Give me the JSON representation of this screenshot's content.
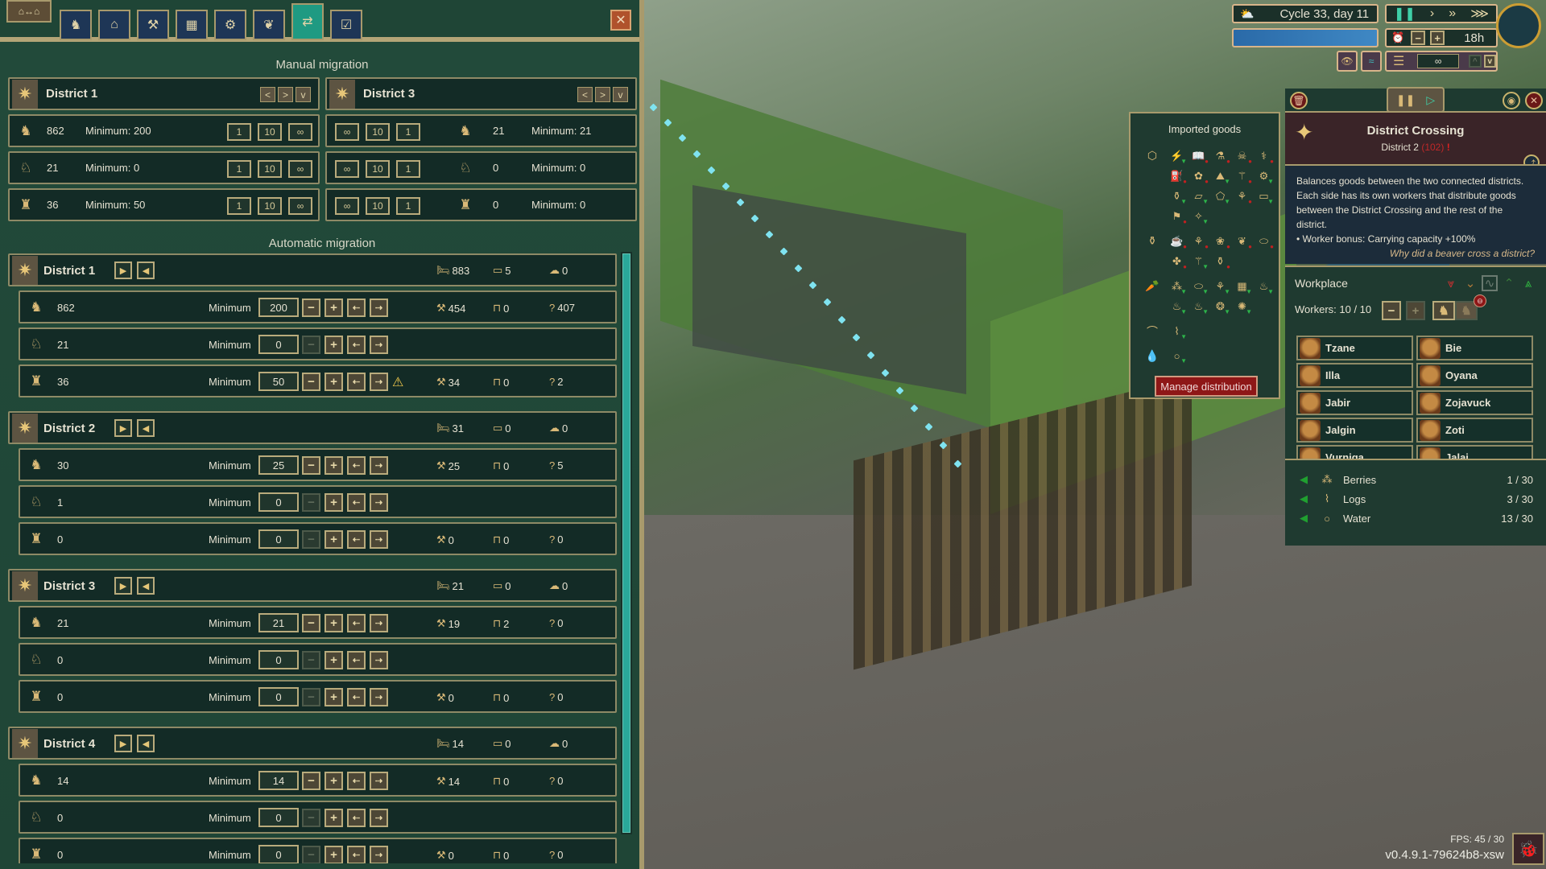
{
  "tabs": {
    "home_label": "⌂↔⌂",
    "items": [
      {
        "name": "tab-population",
        "icon": "♞"
      },
      {
        "name": "tab-housing",
        "icon": "⌂"
      },
      {
        "name": "tab-workplaces",
        "icon": "⚒"
      },
      {
        "name": "tab-storage",
        "icon": "▦"
      },
      {
        "name": "tab-power",
        "icon": "⚙"
      },
      {
        "name": "tab-wellbeing",
        "icon": "❦"
      },
      {
        "name": "tab-migration",
        "icon": "⇄"
      },
      {
        "name": "tab-distribution",
        "icon": "☑"
      }
    ],
    "close_label": "✕"
  },
  "manual": {
    "title": "Manual migration",
    "left": {
      "district": "District 1",
      "rows": [
        {
          "count": "862",
          "minimum": "Minimum: 200"
        },
        {
          "count": "21",
          "minimum": "Minimum: 0"
        },
        {
          "count": "36",
          "minimum": "Minimum: 50"
        }
      ]
    },
    "right": {
      "district": "District 3",
      "rows": [
        {
          "count": "21",
          "minimum": "Minimum: 21"
        },
        {
          "count": "0",
          "minimum": "Minimum: 0"
        },
        {
          "count": "0",
          "minimum": "Minimum: 0"
        }
      ]
    },
    "send_buttons": [
      "1",
      "10",
      "∞"
    ],
    "receive_buttons": [
      "∞",
      "10",
      "1"
    ],
    "nav": {
      "prev": "<",
      "next": ">",
      "dropdown": "v"
    }
  },
  "auto": {
    "title": "Automatic migration",
    "minimum_label": "Minimum",
    "districts": [
      {
        "name": "District 1",
        "beds_total": "883",
        "beds_free": "5",
        "homeless": "0",
        "rows": [
          {
            "count": "862",
            "minimum": "200",
            "minus_enabled": true,
            "employed": "454",
            "unemployed_bench": "0",
            "idle": "407",
            "warning": false
          },
          {
            "count": "21",
            "minimum": "0",
            "minus_enabled": false
          },
          {
            "count": "36",
            "minimum": "50",
            "minus_enabled": true,
            "employed": "34",
            "unemployed_bench": "0",
            "idle": "2",
            "warning": true
          }
        ]
      },
      {
        "name": "District 2",
        "beds_total": "31",
        "beds_free": "0",
        "homeless": "0",
        "rows": [
          {
            "count": "30",
            "minimum": "25",
            "minus_enabled": true,
            "employed": "25",
            "unemployed_bench": "0",
            "idle": "5"
          },
          {
            "count": "1",
            "minimum": "0",
            "minus_enabled": false
          },
          {
            "count": "0",
            "minimum": "0",
            "minus_enabled": false,
            "employed": "0",
            "unemployed_bench": "0",
            "idle": "0"
          }
        ]
      },
      {
        "name": "District 3",
        "beds_total": "21",
        "beds_free": "0",
        "homeless": "0",
        "rows": [
          {
            "count": "21",
            "minimum": "21",
            "minus_enabled": true,
            "employed": "19",
            "unemployed_bench": "2",
            "idle": "0"
          },
          {
            "count": "0",
            "minimum": "0",
            "minus_enabled": false
          },
          {
            "count": "0",
            "minimum": "0",
            "minus_enabled": false,
            "employed": "0",
            "unemployed_bench": "0",
            "idle": "0"
          }
        ]
      },
      {
        "name": "District 4",
        "beds_total": "14",
        "beds_free": "0",
        "homeless": "0",
        "rows": [
          {
            "count": "14",
            "minimum": "14",
            "minus_enabled": true,
            "employed": "14",
            "unemployed_bench": "0",
            "idle": "0"
          },
          {
            "count": "0",
            "minimum": "0",
            "minus_enabled": false
          },
          {
            "count": "0",
            "minimum": "0",
            "minus_enabled": false,
            "employed": "0",
            "unemployed_bench": "0",
            "idle": "0"
          }
        ]
      }
    ]
  },
  "hud": {
    "cycle": "Cycle 33, day 11",
    "time_remaining": "18h",
    "layer_value": "∞",
    "speeds": [
      "❚❚",
      "›",
      "»",
      "⋙"
    ]
  },
  "imported_goods": {
    "title": "Imported goods",
    "rows": [
      {
        "category": "⬡",
        "goods": [
          [
            "⚡",
            "down"
          ],
          [
            "📖",
            "blocked"
          ],
          [
            "⚗",
            "blocked"
          ],
          [
            "☠",
            "blocked"
          ],
          [
            "⚕",
            "blocked"
          ]
        ]
      },
      {
        "category": "",
        "goods": [
          [
            "⛽",
            "blocked"
          ],
          [
            "✿",
            "blocked"
          ],
          [
            "⛰",
            "down"
          ],
          [
            "⚚",
            "blocked"
          ],
          [
            "⚙",
            "down"
          ]
        ]
      },
      {
        "category": "",
        "goods": [
          [
            "⚱",
            "down"
          ],
          [
            "▱",
            "down"
          ],
          [
            "⬠",
            "down"
          ],
          [
            "⚘",
            "blocked"
          ],
          [
            "▭",
            "down"
          ]
        ]
      },
      {
        "category": "",
        "goods": [
          [
            "⚑",
            "blocked"
          ],
          [
            "✧",
            "down"
          ]
        ]
      },
      {
        "category": "⚱",
        "goods": [
          [
            "☕",
            "blocked"
          ],
          [
            "⚘",
            "blocked"
          ],
          [
            "❀",
            "blocked"
          ],
          [
            "❦",
            "blocked"
          ],
          [
            "⬭",
            "blocked"
          ]
        ]
      },
      {
        "category": "",
        "goods": [
          [
            "✤",
            "blocked"
          ],
          [
            "⚚",
            "down"
          ],
          [
            "⚱",
            "blocked"
          ]
        ]
      },
      {
        "category": "🥕",
        "goods": [
          [
            "⁂",
            "down"
          ],
          [
            "⬭",
            "down"
          ],
          [
            "⚘",
            "down"
          ],
          [
            "▦",
            "down"
          ],
          [
            "♨",
            "down"
          ]
        ]
      },
      {
        "category": "",
        "goods": [
          [
            "♨",
            "down"
          ],
          [
            "♨",
            "down"
          ],
          [
            "❂",
            "down"
          ],
          [
            "✺",
            "down"
          ]
        ]
      },
      {
        "category": "⌒",
        "goods": [
          [
            "⌇",
            "down"
          ]
        ]
      },
      {
        "category": "💧",
        "goods": [
          [
            "○",
            "down"
          ]
        ]
      }
    ],
    "manage_label": "Manage distribution"
  },
  "building": {
    "name": "District Crossing",
    "district": "District 2",
    "district_count": "(102)",
    "alert": "!",
    "description": "Balances goods between the two connected districts. Each side has its own workers that distribute goods between the District Crossing and the rest of the district.",
    "bonus": "• Worker bonus: Carrying capacity +100%",
    "flavor": "Why did a beaver cross a district?",
    "workplace_label": "Workplace",
    "workers_label": "Workers: 10 / 10",
    "workers": [
      "Tzane",
      "Bie",
      "Illa",
      "Oyana",
      "Jabir",
      "Zojavuck",
      "Jalgin",
      "Zoti",
      "Vurniga",
      "Jalai"
    ],
    "inventory": [
      {
        "name": "Berries",
        "amount": "1 / 30",
        "icon": "⁂"
      },
      {
        "name": "Logs",
        "amount": "3 / 30",
        "icon": "⌇"
      },
      {
        "name": "Water",
        "amount": "13 / 30",
        "icon": "○"
      }
    ],
    "priority": [
      "⩔",
      "⌄",
      "∿",
      "⌃",
      "⩓"
    ]
  },
  "footer": {
    "fps": "FPS: 45 / 30",
    "version": "v0.4.9.1-79624b8-xsw"
  },
  "colors": {
    "panel_bg": "#224a3a",
    "row_bg": "#132b26",
    "accent_teal": "#1f9a82",
    "gold": "#b9ab7c",
    "manage_red": "#8e1717"
  }
}
